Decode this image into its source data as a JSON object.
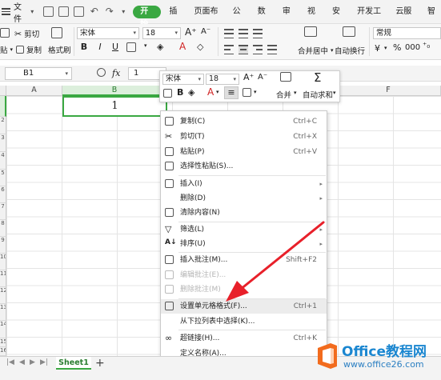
{
  "menubar": {
    "file_label": "文件",
    "tabs": [
      "开始",
      "插入",
      "页面布局",
      "公式",
      "数据",
      "审阅",
      "视图",
      "安全",
      "开发工具",
      "云服务",
      "智"
    ]
  },
  "ribbon": {
    "cut": "剪切",
    "paste": "贴",
    "copy": "复制",
    "format_painter": "格式刷",
    "font_name": "宋体",
    "font_size": "18",
    "merge_center": "合并居中",
    "wrap_text": "自动换行",
    "number_format": "常规",
    "percent_glyph": "%",
    "thousands_glyph": "000"
  },
  "formula_bar": {
    "name_box": "B1",
    "fx_label": "fx",
    "value": "1"
  },
  "grid": {
    "columns": [
      "A",
      "B",
      "C",
      "D",
      "E",
      "F"
    ],
    "active_cell_value": "1",
    "row_numbers": [
      "2",
      "3",
      "4",
      "5",
      "6",
      "7",
      "8",
      "9",
      "10",
      "11",
      "12",
      "13",
      "14",
      "15",
      "16"
    ]
  },
  "mini_toolbar": {
    "font_name": "宋体",
    "font_size": "18",
    "merge": "合并",
    "autosum": "自动求和"
  },
  "context_menu": {
    "items": [
      {
        "label": "复制(C)",
        "shortcut": "Ctrl+C"
      },
      {
        "label": "剪切(T)",
        "shortcut": "Ctrl+X"
      },
      {
        "label": "粘贴(P)",
        "shortcut": "Ctrl+V"
      },
      {
        "label": "选择性粘贴(S)...",
        "shortcut": ""
      },
      {
        "label": "插入(I)",
        "shortcut": ""
      },
      {
        "label": "删除(D)",
        "shortcut": ""
      },
      {
        "label": "清除内容(N)",
        "shortcut": ""
      },
      {
        "label": "筛选(L)",
        "shortcut": ""
      },
      {
        "label": "排序(U)",
        "shortcut": ""
      },
      {
        "label": "插入批注(M)...",
        "shortcut": "Shift+F2"
      },
      {
        "label": "编辑批注(E)...",
        "shortcut": ""
      },
      {
        "label": "删除批注(M)",
        "shortcut": ""
      },
      {
        "label": "设置单元格格式(F)...",
        "shortcut": "Ctrl+1"
      },
      {
        "label": "从下拉列表中选择(K)...",
        "shortcut": ""
      },
      {
        "label": "超链接(H)...",
        "shortcut": "Ctrl+K"
      },
      {
        "label": "定义名称(A)...",
        "shortcut": ""
      }
    ]
  },
  "sheet_tabs": {
    "active": "Sheet1",
    "add_glyph": "+"
  },
  "watermark": {
    "title": "Office教程网",
    "url": "www.office26.com"
  },
  "colors": {
    "accent_green": "#3aa842",
    "arrow_red": "#e8202a",
    "watermark_blue": "#1a86d0",
    "watermark_orange": "#f26b1d"
  }
}
